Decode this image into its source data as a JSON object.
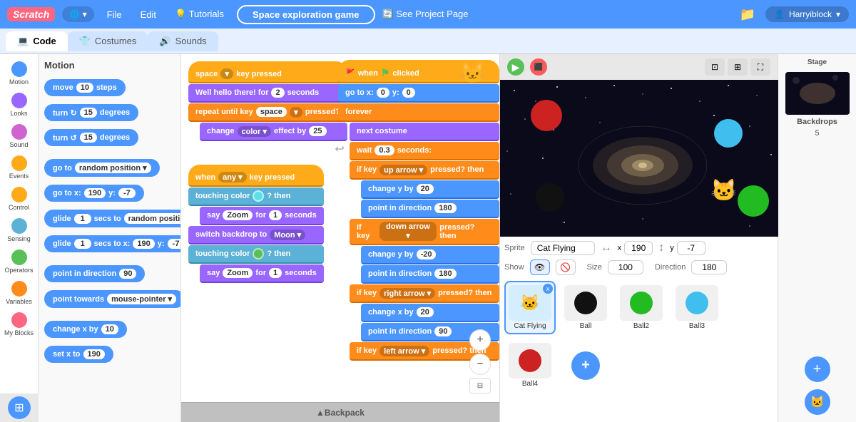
{
  "topnav": {
    "logo": "Scratch",
    "globe_label": "🌐 ▾",
    "file_label": "File",
    "edit_label": "Edit",
    "tutorials_label": "💡 Tutorials",
    "project_name": "Space exploration game",
    "see_project_label": "🔄 See Project Page",
    "folder_icon": "📁",
    "user_avatar": "👤",
    "user_name": "Harryiblock",
    "user_dropdown": "▾"
  },
  "tabs": {
    "code_label": "Code",
    "costumes_label": "Costumes",
    "sounds_label": "Sounds"
  },
  "categories": [
    {
      "id": "motion",
      "label": "Motion",
      "color": "#4C97FF"
    },
    {
      "id": "looks",
      "label": "Looks",
      "color": "#9966FF"
    },
    {
      "id": "sound",
      "label": "Sound",
      "color": "#CF63CF"
    },
    {
      "id": "events",
      "label": "Events",
      "color": "#FFAB19"
    },
    {
      "id": "control",
      "label": "Control",
      "color": "#FFAB19"
    },
    {
      "id": "sensing",
      "label": "Sensing",
      "color": "#5CB1D6"
    },
    {
      "id": "operators",
      "label": "Operators",
      "color": "#59C059"
    },
    {
      "id": "variables",
      "label": "Variables",
      "color": "#FF8C1A"
    },
    {
      "id": "myblocks",
      "label": "My Blocks",
      "color": "#FF6680"
    }
  ],
  "blocks_panel": {
    "title": "Motion",
    "blocks": [
      {
        "label": "move 10 steps",
        "color": "#4C97FF"
      },
      {
        "label": "turn ↻ 15 degrees",
        "color": "#4C97FF"
      },
      {
        "label": "turn ↺ 15 degrees",
        "color": "#4C97FF"
      },
      {
        "label": "go to random position ▾",
        "color": "#4C97FF"
      },
      {
        "label": "go to x: 190 y: -7",
        "color": "#4C97FF"
      },
      {
        "label": "glide 1 secs to random position ▾",
        "color": "#4C97FF"
      },
      {
        "label": "glide 1 secs to x: 190 y: -7",
        "color": "#4C97FF"
      },
      {
        "label": "point in direction 90",
        "color": "#4C97FF"
      },
      {
        "label": "point towards mouse-pointer ▾",
        "color": "#4C97FF"
      },
      {
        "label": "change x by 10",
        "color": "#4C97FF"
      },
      {
        "label": "set x to 190",
        "color": "#4C97FF"
      }
    ]
  },
  "sprite_info": {
    "label_sprite": "Sprite",
    "name": "Cat Flying",
    "label_x": "x",
    "x_val": "190",
    "label_y": "y",
    "y_val": "-7",
    "label_show": "Show",
    "label_size": "Size",
    "size_val": "100",
    "label_direction": "Direction",
    "direction_val": "180"
  },
  "sprites": [
    {
      "id": "cat-flying",
      "name": "Cat Flying",
      "icon": "🐱",
      "active": true,
      "badge": true
    },
    {
      "id": "ball",
      "name": "Ball",
      "icon": "⚫",
      "active": false
    },
    {
      "id": "ball2",
      "name": "Ball2",
      "icon": "🟢",
      "active": false
    },
    {
      "id": "ball3",
      "name": "Ball3",
      "icon": "🔵",
      "active": false
    },
    {
      "id": "ball4",
      "name": "Ball4",
      "icon": "🔴",
      "active": false
    }
  ],
  "stage": {
    "label": "Stage",
    "backdrops_label": "Backdrops",
    "backdrops_count": "5"
  },
  "backpack": {
    "label": "Backpack"
  },
  "script_left": {
    "blocks": [
      {
        "text": "space ▾ key pressed",
        "type": "yellow",
        "hat": true
      },
      {
        "text": "Well hello there! for 2 seconds",
        "type": "purple"
      },
      {
        "text": "repeat until  key space ▾ pressed?",
        "type": "orange"
      },
      {
        "text": "change color ▾ effect by 25",
        "type": "purple"
      }
    ]
  },
  "script_left2": {
    "blocks": [
      {
        "text": "when any ▾ key pressed",
        "type": "yellow",
        "hat": true
      },
      {
        "text": "touching color ? then",
        "type": "cyan"
      },
      {
        "text": "say Zoom for 1 seconds",
        "type": "purple"
      },
      {
        "text": "switch backdrop to Moon ▾",
        "type": "purple"
      },
      {
        "text": "touching color ? then",
        "type": "cyan"
      },
      {
        "text": "say Zoom for 1 seconds",
        "type": "purple"
      }
    ]
  },
  "script_right": {
    "blocks": [
      {
        "text": "when 🚩 clicked",
        "type": "yellow",
        "hat": true
      },
      {
        "text": "go to x: 0 y: 0",
        "type": "blue"
      },
      {
        "text": "forever",
        "type": "orange"
      },
      {
        "text": "next costume",
        "type": "purple"
      },
      {
        "text": "wait 0.3 seconds:",
        "type": "orange"
      },
      {
        "text": "if  key up arrow ▾ pressed?  then",
        "type": "orange"
      },
      {
        "text": "change y by 20",
        "type": "blue"
      },
      {
        "text": "point in direction 180",
        "type": "blue"
      },
      {
        "text": "if  key down arrow ▾ pressed?  then",
        "type": "orange"
      },
      {
        "text": "change y by -20",
        "type": "blue"
      },
      {
        "text": "point in direction 180",
        "type": "blue"
      },
      {
        "text": "if  key right arrow ▾ pressed?  then",
        "type": "orange"
      },
      {
        "text": "change x by 20",
        "type": "blue"
      },
      {
        "text": "point in direction 90",
        "type": "blue"
      },
      {
        "text": "if  key left arrow ▾ pressed?  then",
        "type": "orange"
      }
    ]
  }
}
